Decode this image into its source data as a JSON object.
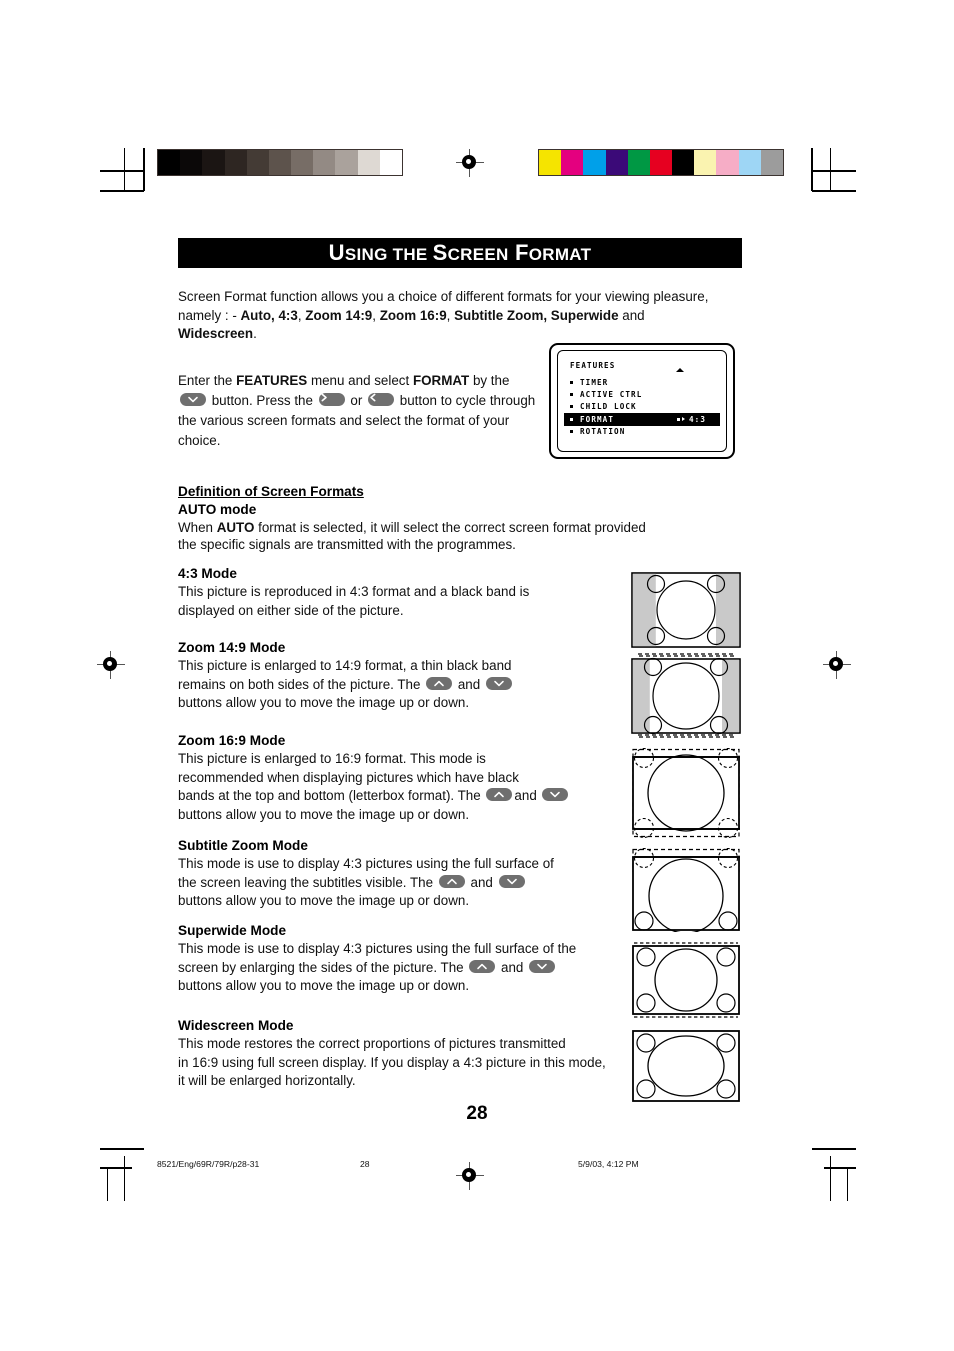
{
  "page": {
    "number": "28",
    "title_parts": {
      "u": "U",
      "sing": "SING",
      "the": " THE ",
      "s": "S",
      "creen": "CREEN",
      "f": " F",
      "ormat": "ORMAT"
    },
    "title_full": "Using the Screen Format"
  },
  "intro": {
    "line1_a": "Screen Format function allows you a choice of different formats for your viewing pleasure,",
    "line2_a": "namely : -  ",
    "formats_bold_1": "Auto, 4:3",
    "sep1": ", ",
    "formats_bold_2": "Zoom 14:9",
    "sep2": ", ",
    "formats_bold_3": "Zoom 16:9",
    "sep3": ", ",
    "formats_bold_4": "Subtitle Zoom, Superwide",
    "and": " and",
    "formats_bold_5": "Widescreen",
    "period": "."
  },
  "enter_para": {
    "t1": "Enter the ",
    "b1": "FEATURES",
    "t2": " menu and select ",
    "b2": "FORMAT",
    "t3": " by the",
    "t4": " button. Press the ",
    "t5": " or ",
    "t6": " button to cycle through",
    "t7": "the various screen formats and select the format of your",
    "t8": "choice."
  },
  "osd": {
    "title": "FEATURES",
    "rows": [
      {
        "label": "TIMER",
        "value": "",
        "selected": false
      },
      {
        "label": "ACTIVE CTRL",
        "value": "",
        "selected": false
      },
      {
        "label": "CHILD LOCK",
        "value": "",
        "selected": false
      },
      {
        "label": "FORMAT",
        "value": "4:3",
        "selected": true
      },
      {
        "label": "ROTATION",
        "value": "",
        "selected": false
      }
    ]
  },
  "definitions": {
    "heading": "Definition of Screen Formats",
    "auto": {
      "head_bold": "AUTO",
      "head_rest": " mode",
      "body_a": "When ",
      "body_b": "AUTO",
      "body_c": " format is selected, it will select the correct screen format provided",
      "body_d": "the specific signals are transmitted with the programmes."
    }
  },
  "modes": [
    {
      "name": "4:3 Mode",
      "lines": [
        "This picture is reproduced in 4:3 format and a black band is",
        "displayed on either side of the picture."
      ],
      "buttons": []
    },
    {
      "name": "Zoom 14:9 Mode",
      "lines": [
        "This picture is enlarged to 14:9 format, a thin black band",
        "remains on both sides of the picture. The ",
        " and ",
        "buttons allow you to move the image up or down."
      ],
      "buttons": [
        "up",
        "down"
      ]
    },
    {
      "name": "Zoom 16:9 Mode",
      "lines": [
        "This picture is enlarged to 16:9 format. This mode is",
        "recommended when displaying pictures which have black",
        "bands at the top and bottom (letterbox format). The ",
        "and ",
        " buttons allow you to move the image up or down."
      ],
      "buttons": [
        "up",
        "down"
      ]
    },
    {
      "name": " Subtitle Zoom Mode",
      "lines": [
        "This mode is use to display 4:3 pictures using the full surface of",
        "the screen leaving the subtitles visible. The ",
        " and ",
        "buttons allow you to move the image up or down."
      ],
      "buttons": [
        "up",
        "down"
      ]
    },
    {
      "name": "Superwide Mode",
      "lines": [
        "This mode is use to display 4:3 pictures using the full surface of the",
        "screen by enlarging the sides of the picture. The ",
        " and ",
        "buttons allow you to move the image up or down."
      ],
      "buttons": [
        "up",
        "down"
      ]
    },
    {
      "name": "Widescreen Mode",
      "lines": [
        "This mode restores the correct proportions of pictures transmitted",
        "in 16:9 using full screen display.  If you display a 4:3 picture in this mode,",
        "it will be enlarged horizontally."
      ],
      "buttons": []
    }
  ],
  "footer": {
    "job": "8521/Eng/69R/79R/p28-31",
    "page": "28",
    "timestamp": "5/9/03, 4:12 PM"
  },
  "calibration": {
    "gray_bar": [
      "#000000",
      "#0b0808",
      "#1b1513",
      "#2e2622",
      "#443b35",
      "#5d534c",
      "#776d66",
      "#938a84",
      "#aaa29c",
      "#ded9d3",
      "#ffffff"
    ],
    "color_bar": [
      "#f5e400",
      "#e4007f",
      "#00a0e9",
      "#3b0a78",
      "#009844",
      "#e60020",
      "#000000",
      "#faf3b0",
      "#f6adc6",
      "#9ed6f5",
      "#9c9c9c"
    ]
  }
}
